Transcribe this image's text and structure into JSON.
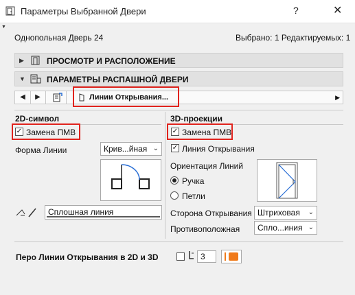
{
  "window": {
    "title": "Параметры Выбранной Двери",
    "help": "?",
    "close": "✕"
  },
  "header": {
    "element": "Однопольная Дверь 24",
    "status": "Выбрано: 1 Редактируемых: 1"
  },
  "sections": [
    {
      "label": "ПРОСМОТР И РАСПОЛОЖЕНИЕ",
      "expanded": false
    },
    {
      "label": "ПАРАМЕТРЫ РАСПАШНОЙ ДВЕРИ",
      "expanded": true
    }
  ],
  "toolbar": {
    "prev": "◀",
    "next": "▶",
    "active_tab": "Линии Открывания...",
    "scroll_right": "▶"
  },
  "symbol2d": {
    "heading": "2D-символ",
    "override_label": "Замена ПМВ",
    "override_checked": true,
    "line_form_label": "Форма Линии",
    "line_form_value": "Крив...йная",
    "line_type_value": "Сплошная линия"
  },
  "projection3d": {
    "heading": "3D-проекции",
    "override_label": "Замена ПМВ",
    "override_checked": true,
    "opening_line_label": "Линия Открывания",
    "opening_line_checked": true,
    "orientation_label": "Ориентация Линий",
    "radio_handle": "Ручка",
    "radio_hinges": "Петли",
    "selected_radio": "Ручка",
    "opening_side_label": "Сторона Открывания",
    "opening_side_value": "Штриховая",
    "opposite_label": "Противоположная",
    "opposite_value": "Спло...иния"
  },
  "pen": {
    "label": "Перо Линии Открывания в 2D и 3D",
    "value": "3",
    "color": "#f07a1a"
  },
  "colors": {
    "highlight": "#e0231d"
  }
}
